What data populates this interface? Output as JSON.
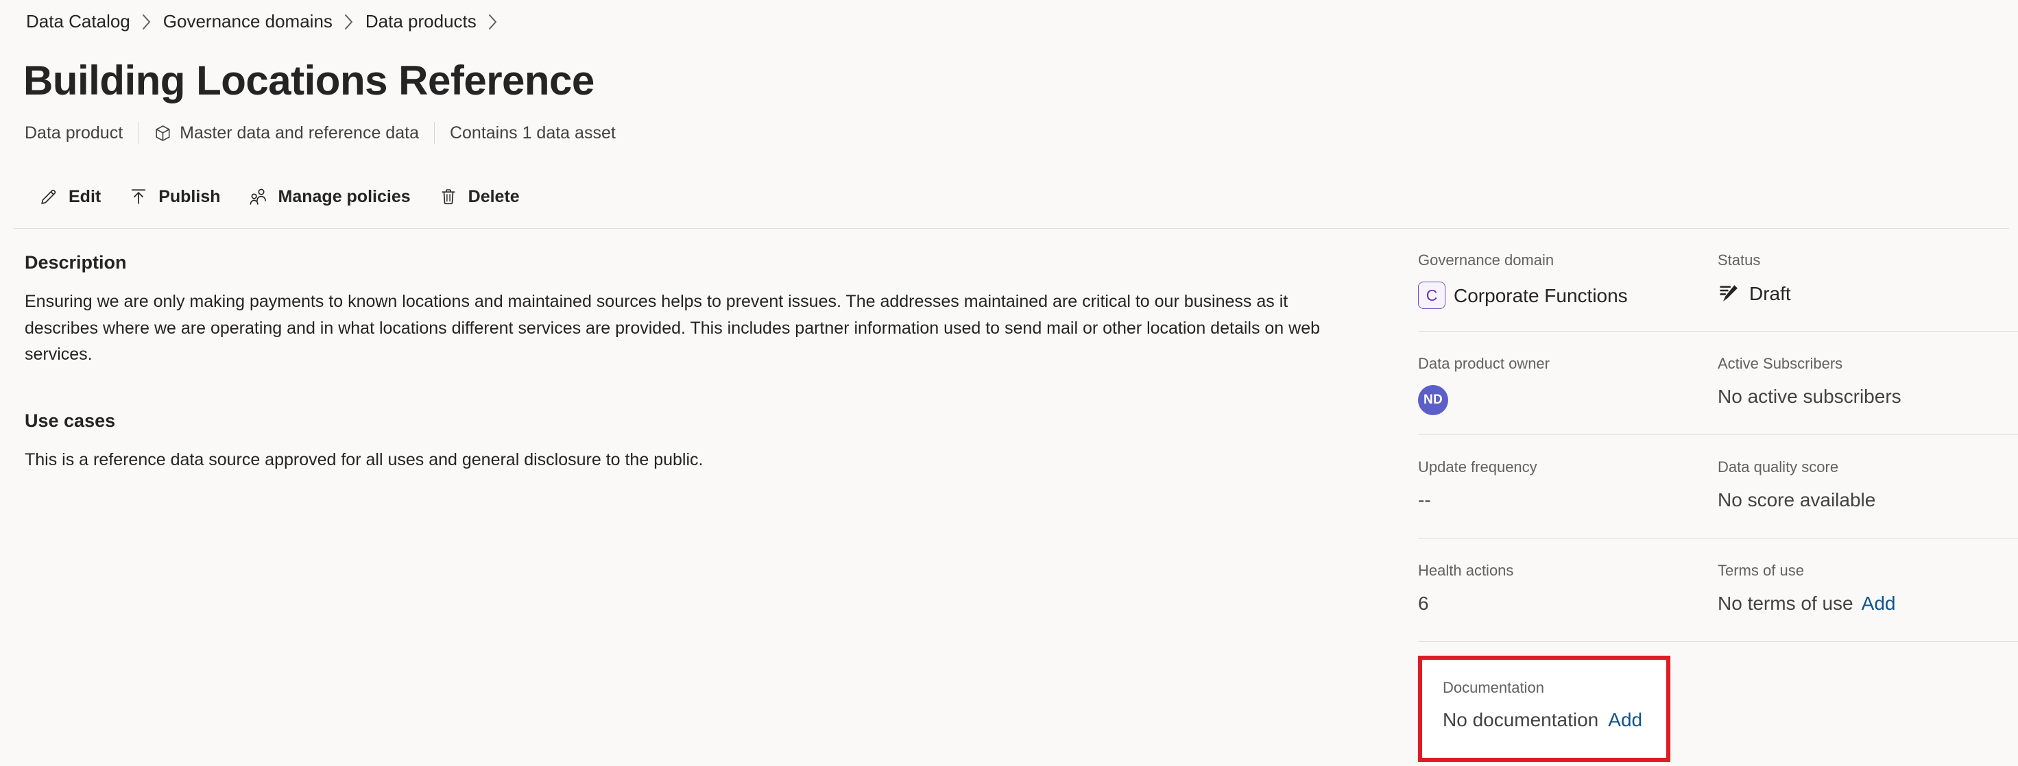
{
  "breadcrumb": {
    "items": [
      {
        "label": "Data Catalog"
      },
      {
        "label": "Governance domains"
      },
      {
        "label": "Data products"
      }
    ]
  },
  "header": {
    "title": "Building Locations Reference",
    "meta": [
      {
        "label": "Data product",
        "icon": null
      },
      {
        "label": "Master data and reference data",
        "icon": "cube-icon"
      },
      {
        "label": "Contains 1 data asset",
        "icon": null
      }
    ]
  },
  "toolbar": {
    "edit_label": "Edit",
    "publish_label": "Publish",
    "manage_policies_label": "Manage policies",
    "delete_label": "Delete"
  },
  "main": {
    "description_heading": "Description",
    "description_body": "Ensuring we are only making payments to known locations and maintained sources helps to prevent issues.  The addresses maintained are critical to our business as it describes where we are operating and in what locations different services are provided.  This includes partner information used to send mail or other location details on web services.",
    "use_cases_heading": "Use cases",
    "use_cases_body": "This is a reference data source approved for all uses and general disclosure to the public."
  },
  "details": {
    "governance_domain": {
      "label": "Governance domain",
      "badge_initial": "C",
      "value": "Corporate Functions",
      "badge_color": "#6b2fb8"
    },
    "status": {
      "label": "Status",
      "value": "Draft",
      "icon": "draft-pencil-icon"
    },
    "owner": {
      "label": "Data product owner",
      "avatar_initials": "ND",
      "avatar_color": "#5b5fc7"
    },
    "active_subscribers": {
      "label": "Active Subscribers",
      "value": "No active subscribers"
    },
    "update_frequency": {
      "label": "Update frequency",
      "value": "--"
    },
    "data_quality_score": {
      "label": "Data quality score",
      "value": "No score available"
    },
    "health_actions": {
      "label": "Health actions",
      "value": "6"
    },
    "terms_of_use": {
      "label": "Terms of use",
      "value": "No terms of use",
      "action_label": "Add"
    },
    "documentation": {
      "label": "Documentation",
      "value": "No documentation",
      "action_label": "Add",
      "highlight_color": "#e01b24"
    }
  }
}
